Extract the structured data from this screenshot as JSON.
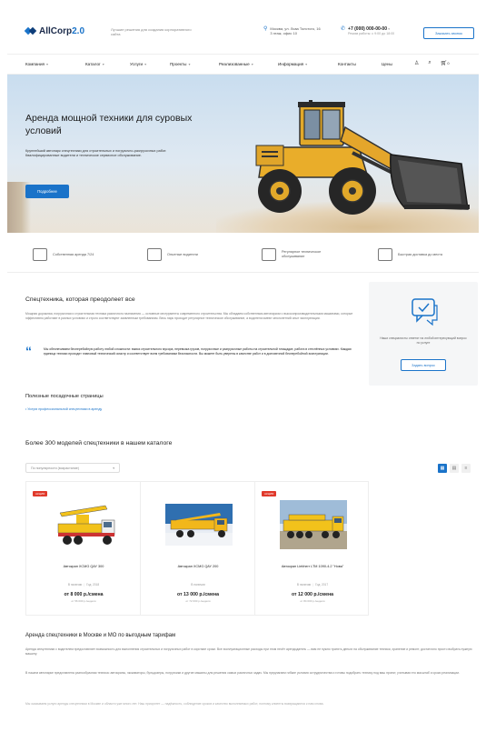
{
  "header": {
    "logo_text": "AllCorp",
    "logo_version": "2.0",
    "tagline": "Лучшие решения для создания корпоративного сайта",
    "address_line1": "Москва, ул. Льва Толстого, 16",
    "address_line2": "3 этаж, офис 10",
    "phone": "+7 (000) 000-00-00",
    "phone_sub": "Режим работы: с 9:00 до 18:00",
    "callback_label": "Заказать звонок"
  },
  "nav": {
    "items": [
      {
        "label": "Компания",
        "has_caret": true
      },
      {
        "label": "Каталог",
        "has_caret": true
      },
      {
        "label": "Услуги",
        "has_caret": true
      },
      {
        "label": "Проекты",
        "has_caret": true
      },
      {
        "label": "Реализованные",
        "has_caret": true
      },
      {
        "label": "Информация",
        "has_caret": true
      },
      {
        "label": "Контакты",
        "has_caret": false
      },
      {
        "label": "Цены",
        "has_caret": false
      }
    ],
    "cart_count": "0"
  },
  "hero": {
    "title": "Аренда мощной техники для суровых условий",
    "text": "Крупнейший автопарк спецтехники для строительных и погрузочно-разгрузочных работ. Квалифицированные водители и техническое сервисное обслуживание.",
    "button_label": "Подробнее"
  },
  "features": [
    {
      "icon": "calendar-icon",
      "text": "Собственная аренда 7/24"
    },
    {
      "icon": "clipboard-icon",
      "text": "Опытные водители"
    },
    {
      "icon": "building-icon",
      "text": "Регулярное техническое обслуживание"
    },
    {
      "icon": "truck-icon",
      "text": "Быстрая доставка до места"
    }
  ],
  "about": {
    "title": "Спецтехника, которая преодолеет все",
    "text": "Мощная дорожная, погрузочная и строительная техника различного назначения — основные инструменты современного строительства. Мы обладаем собственным автопарком с высокопроизводительными машинами, которые эффективно работают в разных условиях и строго соответствуют заявленным требованиям. Весь парк проходит регулярное техническое обслуживание, а водители имеют многолетний опыт эксплуатации.",
    "quote": "Мы обеспечиваем бесперебойную работу любой сложности: вывоз строительного мусора, перевозка грузов, погрузочные и разгрузочные работы на строительной площадке, работа в стеснённых условиях. Каждая единица техники проходит плановый технический осмотр и соответствует всем требованиям безопасности. Вы можете быть уверены в качестве работ и в долговечной бесперебойной эксплуатации.",
    "useful_title": "Полезные посадочные страницы",
    "useful_link": "Услуги профессиональной спецтехники в аренду"
  },
  "side_card": {
    "text": "Наши специалисты ответят на любой интересующий вопрос по услуге",
    "button_label": "Задать вопрос"
  },
  "catalog": {
    "title": "Более 300 моделей спецтехники в нашем каталоге",
    "sort_label": "По популярности (возрастание)",
    "products": [
      {
        "sale": "АКЦИЯ",
        "name": "Автокран XCMG QAY 300",
        "location": "В наличии",
        "year": "Год: 2018",
        "price": "от 8 000 р./смена",
        "price_sub": "от 56 000 р./неделя"
      },
      {
        "sale": "",
        "name": "Автокран XCMG QAY 200",
        "location": "В наличии",
        "year": "",
        "price": "от 13 000 р./смена",
        "price_sub": "от 72 000 р./неделя"
      },
      {
        "sale": "АКЦИЯ",
        "name": "Автокран Liebherr LTM 1090-4.2 \"Нова\"",
        "location": "В наличии",
        "year": "Год: 2017",
        "price": "от 12 000 р./смена",
        "price_sub": "от 84 000 р./неделя"
      }
    ]
  },
  "rent": {
    "title": "Аренда спецтехники в Москве и МО по выгодным тарифам",
    "p1": "Аренда спецтехники с водителем предоставляет возможность для выполнения строительных и погрузочных работ в короткие сроки. Все эксплуатационные расходы при этом несёт арендодатель — вам не нужно тратить деньги на обслуживание техники, хранение и ремонт, достаточно просто выбрать нужную машину.",
    "p2": "В нашем автопарке представлена разнообразная техника: автокраны, экскаваторы, бульдозеры, погрузчики и другие машины для решения самых различных задач. Мы предлагаем гибкие условия сотрудничества и готовы подобрать технику под ваш проект, учитывая его масштаб и сроки реализации.",
    "p3": "Мы оказываем услуги аренды спецтехники в Москве и области уже много лет. Наш приоритет — надёжность, соблюдение сроков и качество выполняемых работ, поэтому клиенты возвращаются к нам снова."
  }
}
